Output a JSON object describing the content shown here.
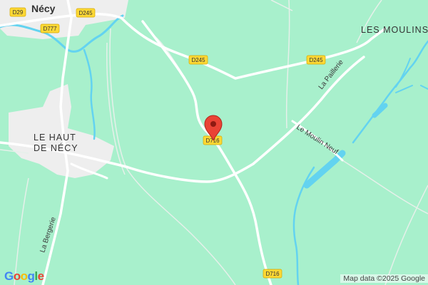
{
  "map": {
    "places": {
      "necy": "Nécy",
      "les_moulins": "LES MOULINS",
      "le_haut_line1": "LE HAUT",
      "le_haut_line2": "DE NÉCY"
    },
    "roads": {
      "d29": "D29",
      "d245_top": "D245",
      "d777": "D777",
      "d245_mid": "D245",
      "d245_right": "D245",
      "d716_pin": "D716",
      "d716_bottom": "D716"
    },
    "streets": {
      "la_paillerie": "La Paillerie",
      "le_moulin_neuf": "Le Moulin Neuf",
      "la_bergerie": "La Bergerie"
    },
    "logo": "Google",
    "attribution": "Map data ©2025 Google",
    "colors": {
      "land": "#a8f0cc",
      "water": "#63d3f0",
      "road": "#ffffff",
      "urban": "#eeeeee",
      "shield": "#fdd835",
      "pin": "#ea4335"
    }
  }
}
